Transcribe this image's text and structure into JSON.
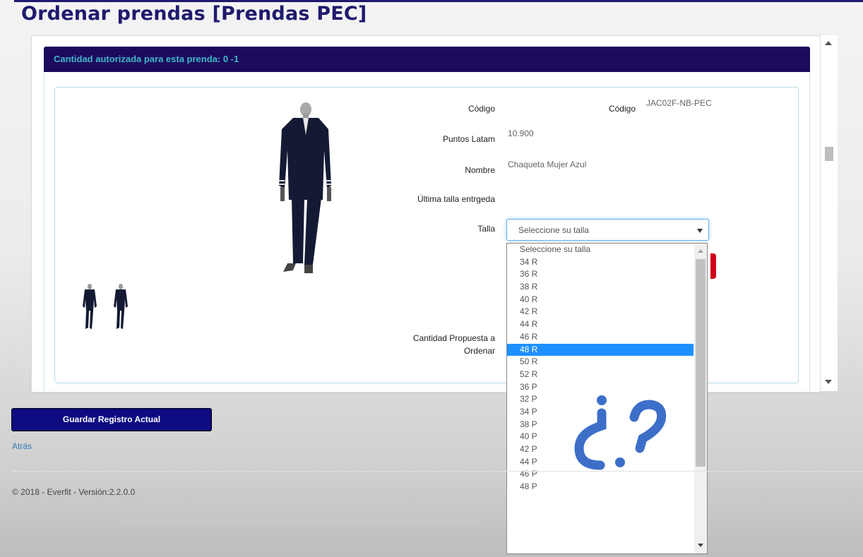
{
  "page": {
    "title": "Ordenar prendas [Prendas PEC]"
  },
  "panel": {
    "heading": "Cantidad autorizada para esta prenda: 0 -1"
  },
  "product": {
    "codigo_label": "Código",
    "codigo_label_2": "Código",
    "codigo_value": "JAC02F-NB-PEC",
    "puntos_label": "Puntos Latam",
    "puntos_value": "10.900",
    "nombre_label": "Nombre",
    "nombre_value": "Chaqueta Mujer Azul",
    "ultima_label": "Última talla entrgeda",
    "talla_label": "Talla",
    "talla_selected": "Seleccione su talla",
    "cantidad_label_1": "Cantidad Propuesta a",
    "cantidad_label_2": "Ordenar"
  },
  "dropdown": {
    "options": [
      "Seleccione su talla",
      "34 R",
      "36 R",
      "38 R",
      "40 R",
      "42 R",
      "44 R",
      "46 R",
      "48 R",
      "50 R",
      "52 R",
      "36 P",
      "32 P",
      "34 P",
      "38 P",
      "40 P",
      "42 P",
      "44 P",
      "46 P",
      "48 P"
    ],
    "highlighted": "48 R"
  },
  "actions": {
    "save_label": "Guardar Registro Actual",
    "back_label": "Atrás"
  },
  "footer": {
    "text": "© 2018 - Everfit - Versión:2.2.0.0"
  },
  "overlay": {
    "question_mark": "¿?"
  },
  "colors": {
    "title": "#1f1a6e",
    "heading_bg": "#1c0a5e",
    "heading_text": "#3fb8c7",
    "save_bg": "#0d0a82",
    "highlight": "#1e90ff",
    "question": "#3d6fc8"
  }
}
